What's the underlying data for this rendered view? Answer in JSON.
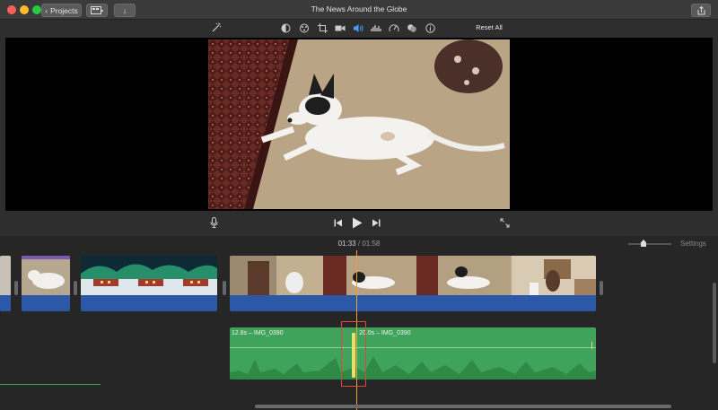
{
  "window": {
    "title": "The News Around the Globe",
    "projects_label": "Projects",
    "traffic_colors": [
      "#fe5f57",
      "#febc2e",
      "#28c840"
    ]
  },
  "toolbar": {
    "tools": [
      "magic-wand-icon",
      "color-balance-icon",
      "color-palette-icon",
      "crop-icon",
      "camera-icon",
      "volume-icon",
      "equalizer-icon",
      "speed-icon",
      "filter-icon",
      "info-icon"
    ],
    "reset_label": "Reset All",
    "active_tool": "volume-icon"
  },
  "playback": {
    "current_time": "01:33",
    "separator": "/",
    "total_time": "01:58"
  },
  "timeline": {
    "settings_label": "Settings",
    "audio_clips": [
      {
        "label": "12.8s – IMG_0390"
      },
      {
        "label": "20.0s – IMG_0390"
      }
    ],
    "clip_bar_color": "#2c58a8",
    "audio_color": "#3fa35b",
    "playhead_color": "#f0a030"
  }
}
